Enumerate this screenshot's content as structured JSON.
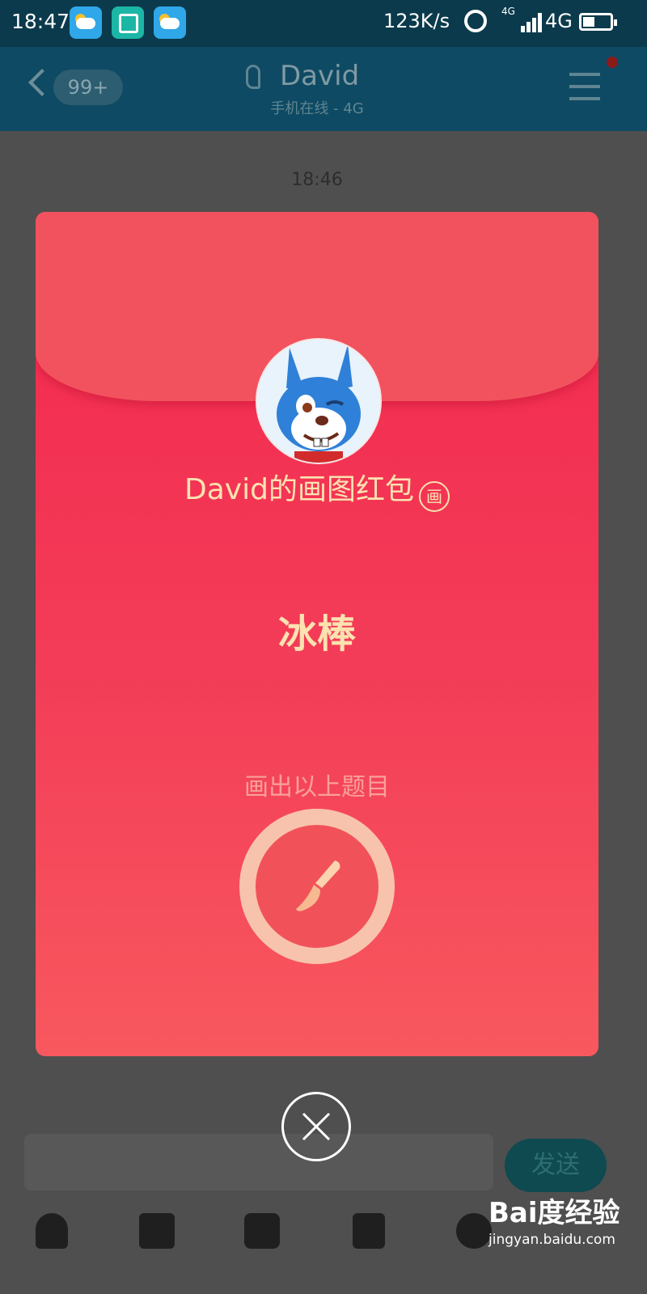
{
  "status_bar": {
    "time": "18:47",
    "net_speed": "123K/s",
    "network_small": "4G",
    "network": "4G"
  },
  "chat": {
    "unread_count": "99+",
    "contact_name": "David",
    "contact_status": "手机在线 - 4G",
    "timestamp": "18:46",
    "send_label": "发送"
  },
  "red_packet": {
    "sender_title": "David的画图红包",
    "type_badge": "画",
    "prompt_word": "冰棒",
    "hint": "画出以上题目",
    "colors": {
      "envelope": "#f33d58",
      "flap": "#f2525e",
      "gold_text": "#fbe2b0",
      "button_ring": "#f8c3ac"
    }
  },
  "watermark": {
    "brand": "Bai度经验",
    "domain": "jingyan.baidu.com"
  },
  "icons": [
    "back-chevron-icon",
    "ear-icon",
    "menu-icon",
    "mic-icon",
    "image-icon",
    "camera-icon",
    "red-packet-icon",
    "emoji-icon",
    "brush-icon",
    "close-icon"
  ]
}
